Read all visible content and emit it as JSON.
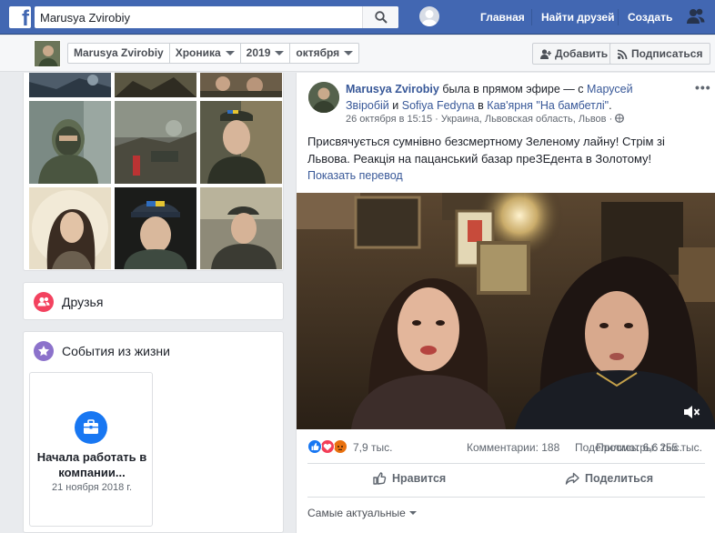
{
  "header": {
    "search_value": "Marusya Zvirobiy",
    "nav": [
      "Главная",
      "Найти друзей",
      "Создать"
    ]
  },
  "subnav": {
    "profile_name": "Marusya Zvirobiy",
    "section": "Хроника",
    "year": "2019",
    "month": "октября",
    "add_button": "Добавить",
    "subscribe_button": "Подписаться"
  },
  "sidebar": {
    "friends_title": "Друзья",
    "life_events_title": "События из жизни",
    "event": {
      "title": "Начала работать в компании...",
      "date": "21 ноября 2018 г."
    }
  },
  "post": {
    "author": "Marusya Zvirobiy",
    "action_text": "была в прямом эфире — с",
    "tagged_1": "Марусей Звіробій",
    "and_text": "и",
    "tagged_2": "Sofiya Fedyna",
    "in_text": "в",
    "place": "Кав'ярня \"На бамбетлі\"",
    "date": "26 октября в 15:15",
    "location": "Украина, Львовская область, Львов",
    "text": "Присвячується сумнівно безсмертному Зеленому лайну! Стрім зі Львова. Реакція на пацанський базар преЗЕдента в Золотому!",
    "translate_link": "Показать перевод",
    "reactions_count": "7,9 тыс.",
    "comments": "Комментарии: 188",
    "shares": "Поделились: 6,6 тыс.",
    "views": "Просмотры: 255 тыс.",
    "like_button": "Нравится",
    "share_button": "Поделиться",
    "sort_label": "Самые актуальные"
  },
  "colors": {
    "brand": "#4267b2",
    "link": "#385898",
    "like": "#1877f2",
    "love": "#f33e58",
    "angry": "#e9710f"
  }
}
